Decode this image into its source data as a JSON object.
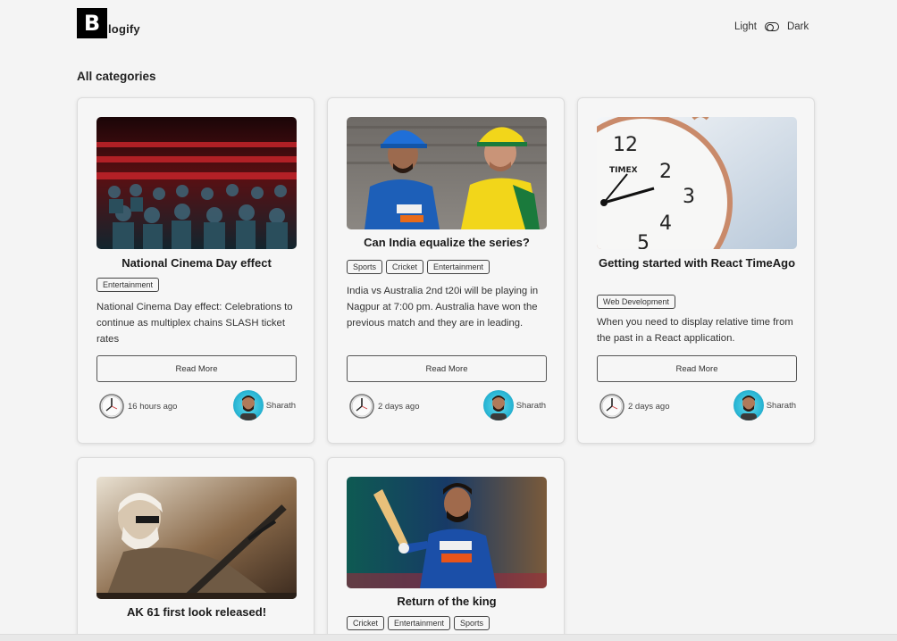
{
  "brand": {
    "letter": "B",
    "name": "logify"
  },
  "theme": {
    "light_label": "Light",
    "dark_label": "Dark"
  },
  "section_title": "All categories",
  "read_more_label": "Read More",
  "posts": [
    {
      "title": "National Cinema Day effect",
      "tags": [
        "Entertainment"
      ],
      "description": "National Cinema Day effect: Celebrations to continue as multiplex chains SLASH ticket rates",
      "time": "16 hours ago",
      "author": "Sharath",
      "image": "cinema-audience-image"
    },
    {
      "title": "Can India equalize the series?",
      "tags": [
        "Sports",
        "Cricket",
        "Entertainment"
      ],
      "description": "India vs Australia 2nd t20i will be playing in Nagpur at 7:00 pm. Australia have won the previous match and they are in leading.",
      "time": "2 days ago",
      "author": "Sharath",
      "image": "cricket-captains-image"
    },
    {
      "title": "Getting started with React TimeAgo",
      "tags": [
        "Web Development"
      ],
      "description": "When you need to display relative time from the past in a React application.",
      "time": "2 days ago",
      "author": "Sharath",
      "image": "clock-image"
    },
    {
      "title": "AK 61 first look released!",
      "tags": [],
      "description": "",
      "time": "",
      "author": "",
      "image": "movie-poster-image"
    },
    {
      "title": "Return of the king",
      "tags": [
        "Cricket",
        "Entertainment",
        "Sports"
      ],
      "description": "",
      "time": "",
      "author": "",
      "image": "cricketer-celebration-image"
    }
  ]
}
